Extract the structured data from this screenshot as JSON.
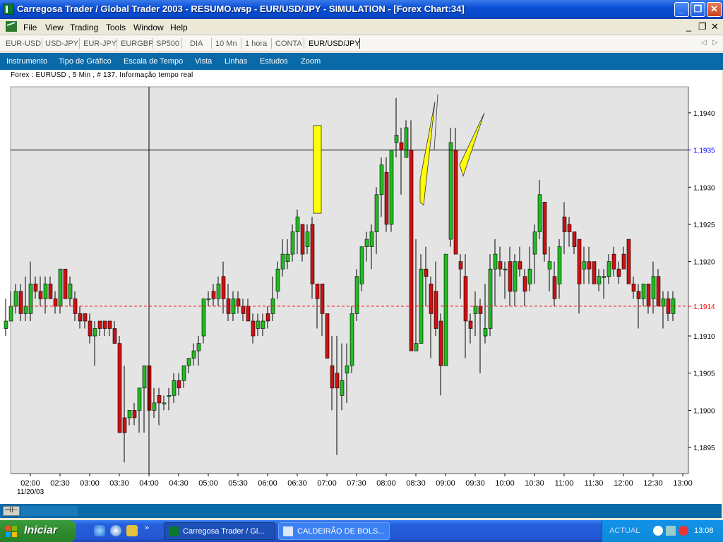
{
  "window": {
    "title": "Carregosa Trader / Global Trader 2003 - RESUMO.wsp - EUR/USD/JPY - SIMULATION - [Forex Chart:34]"
  },
  "title_buttons": {
    "minimize": "_",
    "maximize": "❐",
    "close": "✕"
  },
  "menu": {
    "items": [
      "File",
      "View",
      "Trading",
      "Tools",
      "Window",
      "Help"
    ],
    "mdi_min": "_",
    "mdi_restore": "❐",
    "mdi_close": "✕"
  },
  "symbols": {
    "items": [
      "EUR-USD",
      "USD-JPY",
      "EUR-JPY",
      "EURGBP",
      "SP500",
      "DIA",
      "10 Mn",
      "1 hora",
      "CONTA",
      "EUR/USD/JPY"
    ],
    "active_index": 9,
    "prev": "◁",
    "next": "▷"
  },
  "toolbar": {
    "items": [
      "Instrumento",
      "Tipo de Gráfico",
      "Escala de Tempo",
      "Vista",
      "Linhas",
      "Estudos",
      "Zoom"
    ]
  },
  "chart_info": "Forex : EURUSD , 5 Min , # 137, Informação tempo real",
  "chart_data": {
    "type": "candlestick",
    "date_label": "11/20/03",
    "x_ticks": [
      "02:00",
      "02:30",
      "03:00",
      "03:30",
      "04:00",
      "04:30",
      "05:00",
      "05:30",
      "06:00",
      "06:30",
      "07:00",
      "07:30",
      "08:00",
      "08:30",
      "09:00",
      "09:30",
      "10:00",
      "10:30",
      "11:00",
      "11:30",
      "12:00",
      "12:30",
      "13:00"
    ],
    "y_ticks": [
      "1,1895",
      "1,1900",
      "1,1905",
      "1,1910",
      "1,1920",
      "1,1925",
      "1,1930",
      "1,1940"
    ],
    "ylim": [
      1.18915,
      1.19435
    ],
    "crosshair": {
      "price": "1,1935",
      "time": "04:00",
      "price_color": "#0000ff"
    },
    "last_price": {
      "label": "1,1914",
      "color": "#ff0000",
      "line": "dashed"
    },
    "colors": {
      "up": "#22bb22",
      "down": "#cc1111",
      "background": "#e4e4e4",
      "annotation": "#ffff00"
    },
    "candles": [
      {
        "t": "01:35",
        "o": 1.1911,
        "h": 1.1915,
        "l": 1.191,
        "c": 1.1912
      },
      {
        "t": "01:40",
        "o": 1.1912,
        "h": 1.1916,
        "l": 1.1912,
        "c": 1.1914
      },
      {
        "t": "01:45",
        "o": 1.1914,
        "h": 1.1917,
        "l": 1.1913,
        "c": 1.1916
      },
      {
        "t": "01:50",
        "o": 1.1916,
        "h": 1.1917,
        "l": 1.1912,
        "c": 1.1913
      },
      {
        "t": "01:55",
        "o": 1.1913,
        "h": 1.1918,
        "l": 1.1912,
        "c": 1.1914
      },
      {
        "t": "02:00",
        "o": 1.1913,
        "h": 1.192,
        "l": 1.1912,
        "c": 1.1917
      },
      {
        "t": "02:05",
        "o": 1.1917,
        "h": 1.1918,
        "l": 1.1915,
        "c": 1.1916
      },
      {
        "t": "02:10",
        "o": 1.1916,
        "h": 1.1918,
        "l": 1.1914,
        "c": 1.1915
      },
      {
        "t": "02:15",
        "o": 1.1915,
        "h": 1.1918,
        "l": 1.1913,
        "c": 1.1917
      },
      {
        "t": "02:20",
        "o": 1.1917,
        "h": 1.1918,
        "l": 1.1915,
        "c": 1.1915
      },
      {
        "t": "02:25",
        "o": 1.1915,
        "h": 1.1916,
        "l": 1.1913,
        "c": 1.1914
      },
      {
        "t": "02:30",
        "o": 1.1914,
        "h": 1.1919,
        "l": 1.1913,
        "c": 1.1919
      },
      {
        "t": "02:35",
        "o": 1.1919,
        "h": 1.1919,
        "l": 1.1915,
        "c": 1.1915
      },
      {
        "t": "02:40",
        "o": 1.1915,
        "h": 1.1918,
        "l": 1.1914,
        "c": 1.1917
      },
      {
        "t": "02:45",
        "o": 1.1915,
        "h": 1.1916,
        "l": 1.1912,
        "c": 1.1913
      },
      {
        "t": "02:50",
        "o": 1.1913,
        "h": 1.1914,
        "l": 1.1911,
        "c": 1.1912
      },
      {
        "t": "02:55",
        "o": 1.1913,
        "h": 1.1913,
        "l": 1.1911,
        "c": 1.1912
      },
      {
        "t": "03:00",
        "o": 1.1912,
        "h": 1.1913,
        "l": 1.1909,
        "c": 1.191
      },
      {
        "t": "03:05",
        "o": 1.191,
        "h": 1.1912,
        "l": 1.1906,
        "c": 1.1911
      },
      {
        "t": "03:10",
        "o": 1.1912,
        "h": 1.1912,
        "l": 1.191,
        "c": 1.1911
      },
      {
        "t": "03:15",
        "o": 1.1912,
        "h": 1.1912,
        "l": 1.191,
        "c": 1.1911
      },
      {
        "t": "03:20",
        "o": 1.1912,
        "h": 1.1912,
        "l": 1.191,
        "c": 1.1911
      },
      {
        "t": "03:25",
        "o": 1.1911,
        "h": 1.1912,
        "l": 1.1909,
        "c": 1.1909
      },
      {
        "t": "03:30",
        "o": 1.1909,
        "h": 1.191,
        "l": 1.1899,
        "c": 1.1897
      },
      {
        "t": "03:35",
        "o": 1.1899,
        "h": 1.1906,
        "l": 1.1893,
        "c": 1.1897
      },
      {
        "t": "03:40",
        "o": 1.1899,
        "h": 1.19,
        "l": 1.1898,
        "c": 1.19
      },
      {
        "t": "03:45",
        "o": 1.19,
        "h": 1.1901,
        "l": 1.1898,
        "c": 1.1899
      },
      {
        "t": "03:50",
        "o": 1.19,
        "h": 1.1903,
        "l": 1.1897,
        "c": 1.1903
      },
      {
        "t": "03:55",
        "o": 1.1903,
        "h": 1.1906,
        "l": 1.1897,
        "c": 1.1906
      },
      {
        "t": "04:00",
        "o": 1.1906,
        "h": 1.1906,
        "l": 1.19,
        "c": 1.19
      },
      {
        "t": "04:05",
        "o": 1.19,
        "h": 1.1903,
        "l": 1.1899,
        "c": 1.1901
      },
      {
        "t": "04:10",
        "o": 1.1902,
        "h": 1.1903,
        "l": 1.1898,
        "c": 1.1901
      },
      {
        "t": "04:15",
        "o": 1.1901,
        "h": 1.1902,
        "l": 1.19,
        "c": 1.1901
      },
      {
        "t": "04:20",
        "o": 1.1902,
        "h": 1.1903,
        "l": 1.19,
        "c": 1.1902
      },
      {
        "t": "04:25",
        "o": 1.1902,
        "h": 1.1905,
        "l": 1.1901,
        "c": 1.1904
      },
      {
        "t": "04:30",
        "o": 1.1904,
        "h": 1.1905,
        "l": 1.1902,
        "c": 1.1903
      },
      {
        "t": "04:35",
        "o": 1.1904,
        "h": 1.1906,
        "l": 1.1903,
        "c": 1.1906
      },
      {
        "t": "04:40",
        "o": 1.1906,
        "h": 1.1907,
        "l": 1.1905,
        "c": 1.1907
      },
      {
        "t": "04:45",
        "o": 1.1907,
        "h": 1.1909,
        "l": 1.1906,
        "c": 1.1908
      },
      {
        "t": "04:50",
        "o": 1.1908,
        "h": 1.191,
        "l": 1.1906,
        "c": 1.1909
      },
      {
        "t": "04:55",
        "o": 1.191,
        "h": 1.1915,
        "l": 1.1909,
        "c": 1.1915
      },
      {
        "t": "05:00",
        "o": 1.1915,
        "h": 1.1916,
        "l": 1.1914,
        "c": 1.1915
      },
      {
        "t": "05:05",
        "o": 1.1916,
        "h": 1.1917,
        "l": 1.1914,
        "c": 1.1915
      },
      {
        "t": "05:10",
        "o": 1.1915,
        "h": 1.1918,
        "l": 1.1914,
        "c": 1.1917
      },
      {
        "t": "05:15",
        "o": 1.1918,
        "h": 1.192,
        "l": 1.1913,
        "c": 1.1915
      },
      {
        "t": "05:20",
        "o": 1.1915,
        "h": 1.1917,
        "l": 1.1912,
        "c": 1.1913
      },
      {
        "t": "05:25",
        "o": 1.1913,
        "h": 1.1916,
        "l": 1.1912,
        "c": 1.1915
      },
      {
        "t": "05:30",
        "o": 1.1915,
        "h": 1.1916,
        "l": 1.1913,
        "c": 1.1914
      },
      {
        "t": "05:35",
        "o": 1.1914,
        "h": 1.1915,
        "l": 1.1912,
        "c": 1.1913
      },
      {
        "t": "05:40",
        "o": 1.1914,
        "h": 1.1915,
        "l": 1.1912,
        "c": 1.1912
      },
      {
        "t": "05:45",
        "o": 1.1912,
        "h": 1.1913,
        "l": 1.1909,
        "c": 1.191
      },
      {
        "t": "05:50",
        "o": 1.1911,
        "h": 1.1913,
        "l": 1.191,
        "c": 1.1912
      },
      {
        "t": "05:55",
        "o": 1.1911,
        "h": 1.1913,
        "l": 1.191,
        "c": 1.1912
      },
      {
        "t": "06:00",
        "o": 1.1913,
        "h": 1.1914,
        "l": 1.1911,
        "c": 1.1912
      },
      {
        "t": "06:05",
        "o": 1.1913,
        "h": 1.1918,
        "l": 1.1912,
        "c": 1.1915
      },
      {
        "t": "06:10",
        "o": 1.1916,
        "h": 1.192,
        "l": 1.1915,
        "c": 1.1919
      },
      {
        "t": "06:15",
        "o": 1.1919,
        "h": 1.1923,
        "l": 1.1918,
        "c": 1.1921
      },
      {
        "t": "06:20",
        "o": 1.192,
        "h": 1.1923,
        "l": 1.1919,
        "c": 1.1921
      },
      {
        "t": "06:25",
        "o": 1.1921,
        "h": 1.1925,
        "l": 1.192,
        "c": 1.1924
      },
      {
        "t": "06:30",
        "o": 1.1924,
        "h": 1.1927,
        "l": 1.1921,
        "c": 1.1926
      },
      {
        "t": "06:35",
        "o": 1.1925,
        "h": 1.1925,
        "l": 1.192,
        "c": 1.1921
      },
      {
        "t": "06:40",
        "o": 1.1922,
        "h": 1.1925,
        "l": 1.1921,
        "c": 1.1924
      },
      {
        "t": "06:45",
        "o": 1.1925,
        "h": 1.1926,
        "l": 1.1915,
        "c": 1.1917
      },
      {
        "t": "06:50",
        "o": 1.1917,
        "h": 1.1917,
        "l": 1.1911,
        "c": 1.1915
      },
      {
        "t": "06:55",
        "o": 1.1917,
        "h": 1.1917,
        "l": 1.191,
        "c": 1.1913
      },
      {
        "t": "07:00",
        "o": 1.1913,
        "h": 1.1913,
        "l": 1.1907,
        "c": 1.1907
      },
      {
        "t": "07:05",
        "o": 1.1906,
        "h": 1.191,
        "l": 1.19,
        "c": 1.1903
      },
      {
        "t": "07:10",
        "o": 1.1905,
        "h": 1.191,
        "l": 1.1894,
        "c": 1.1903
      },
      {
        "t": "07:15",
        "o": 1.1902,
        "h": 1.1909,
        "l": 1.19,
        "c": 1.1904
      },
      {
        "t": "07:20",
        "o": 1.1905,
        "h": 1.1909,
        "l": 1.1901,
        "c": 1.1906
      },
      {
        "t": "07:25",
        "o": 1.1906,
        "h": 1.1914,
        "l": 1.1905,
        "c": 1.1913
      },
      {
        "t": "07:30",
        "o": 1.1913,
        "h": 1.1919,
        "l": 1.1912,
        "c": 1.1918
      },
      {
        "t": "07:35",
        "o": 1.1917,
        "h": 1.1922,
        "l": 1.1916,
        "c": 1.1922
      },
      {
        "t": "07:40",
        "o": 1.1922,
        "h": 1.1924,
        "l": 1.192,
        "c": 1.1923
      },
      {
        "t": "07:45",
        "o": 1.1922,
        "h": 1.1925,
        "l": 1.1919,
        "c": 1.1924
      },
      {
        "t": "07:50",
        "o": 1.1924,
        "h": 1.193,
        "l": 1.1921,
        "c": 1.1929
      },
      {
        "t": "07:55",
        "o": 1.1929,
        "h": 1.1934,
        "l": 1.1926,
        "c": 1.1933
      },
      {
        "t": "08:00",
        "o": 1.1932,
        "h": 1.1934,
        "l": 1.1924,
        "c": 1.1925
      },
      {
        "t": "08:05",
        "o": 1.1925,
        "h": 1.1935,
        "l": 1.1924,
        "c": 1.1935
      },
      {
        "t": "08:10",
        "o": 1.1936,
        "h": 1.1942,
        "l": 1.1934,
        "c": 1.1937
      },
      {
        "t": "08:15",
        "o": 1.1936,
        "h": 1.1938,
        "l": 1.1929,
        "c": 1.1935
      },
      {
        "t": "08:20",
        "o": 1.1934,
        "h": 1.1939,
        "l": 1.1934,
        "c": 1.1938
      },
      {
        "t": "08:25",
        "o": 1.1935,
        "h": 1.1939,
        "l": 1.1908,
        "c": 1.1908
      },
      {
        "t": "08:30",
        "o": 1.1908,
        "h": 1.1923,
        "l": 1.1908,
        "c": 1.1909
      },
      {
        "t": "08:35",
        "o": 1.1909,
        "h": 1.1921,
        "l": 1.1909,
        "c": 1.1919
      },
      {
        "t": "08:40",
        "o": 1.1919,
        "h": 1.1922,
        "l": 1.1914,
        "c": 1.1918
      },
      {
        "t": "08:45",
        "o": 1.1917,
        "h": 1.1918,
        "l": 1.1907,
        "c": 1.1913
      },
      {
        "t": "08:50",
        "o": 1.1916,
        "h": 1.192,
        "l": 1.191,
        "c": 1.1911
      },
      {
        "t": "08:55",
        "o": 1.1912,
        "h": 1.1913,
        "l": 1.1902,
        "c": 1.1906
      },
      {
        "t": "09:00",
        "o": 1.1906,
        "h": 1.1921,
        "l": 1.1906,
        "c": 1.1921
      },
      {
        "t": "09:05",
        "o": 1.1923,
        "h": 1.1938,
        "l": 1.1922,
        "c": 1.1936
      },
      {
        "t": "09:10",
        "o": 1.1935,
        "h": 1.1938,
        "l": 1.1921,
        "c": 1.1921
      },
      {
        "t": "09:15",
        "o": 1.192,
        "h": 1.1921,
        "l": 1.1915,
        "c": 1.1919
      },
      {
        "t": "09:20",
        "o": 1.1918,
        "h": 1.1921,
        "l": 1.1907,
        "c": 1.1912
      },
      {
        "t": "09:25",
        "o": 1.1912,
        "h": 1.1913,
        "l": 1.1909,
        "c": 1.1911
      },
      {
        "t": "09:30",
        "o": 1.1913,
        "h": 1.1916,
        "l": 1.191,
        "c": 1.1914
      },
      {
        "t": "09:35",
        "o": 1.1914,
        "h": 1.1915,
        "l": 1.1905,
        "c": 1.1913
      },
      {
        "t": "09:40",
        "o": 1.191,
        "h": 1.1917,
        "l": 1.1909,
        "c": 1.1911
      },
      {
        "t": "09:45",
        "o": 1.1911,
        "h": 1.1921,
        "l": 1.191,
        "c": 1.1919
      },
      {
        "t": "09:50",
        "o": 1.1919,
        "h": 1.1923,
        "l": 1.1914,
        "c": 1.1921
      },
      {
        "t": "09:55",
        "o": 1.192,
        "h": 1.1922,
        "l": 1.1918,
        "c": 1.1919
      },
      {
        "t": "10:00",
        "o": 1.1919,
        "h": 1.192,
        "l": 1.1915,
        "c": 1.1919
      },
      {
        "t": "10:05",
        "o": 1.192,
        "h": 1.1922,
        "l": 1.1914,
        "c": 1.1916
      },
      {
        "t": "10:10",
        "o": 1.1916,
        "h": 1.1921,
        "l": 1.1914,
        "c": 1.192
      },
      {
        "t": "10:15",
        "o": 1.192,
        "h": 1.1922,
        "l": 1.1918,
        "c": 1.1919
      },
      {
        "t": "10:20",
        "o": 1.1918,
        "h": 1.1919,
        "l": 1.1914,
        "c": 1.1916
      },
      {
        "t": "10:25",
        "o": 1.1917,
        "h": 1.1922,
        "l": 1.1916,
        "c": 1.1919
      },
      {
        "t": "10:30",
        "o": 1.1921,
        "h": 1.1925,
        "l": 1.1917,
        "c": 1.1924
      },
      {
        "t": "10:35",
        "o": 1.1924,
        "h": 1.1931,
        "l": 1.1923,
        "c": 1.1929
      },
      {
        "t": "10:40",
        "o": 1.1928,
        "h": 1.1928,
        "l": 1.192,
        "c": 1.1921
      },
      {
        "t": "10:45",
        "o": 1.1919,
        "h": 1.1922,
        "l": 1.1916,
        "c": 1.192
      },
      {
        "t": "10:50",
        "o": 1.1918,
        "h": 1.192,
        "l": 1.1914,
        "c": 1.1915
      },
      {
        "t": "10:55",
        "o": 1.1917,
        "h": 1.1923,
        "l": 1.1915,
        "c": 1.1922
      },
      {
        "t": "11:00",
        "o": 1.1926,
        "h": 1.1928,
        "l": 1.1921,
        "c": 1.1924
      },
      {
        "t": "11:05",
        "o": 1.1925,
        "h": 1.1926,
        "l": 1.1922,
        "c": 1.1924
      },
      {
        "t": "11:10",
        "o": 1.1924,
        "h": 1.1924,
        "l": 1.1921,
        "c": 1.1922
      },
      {
        "t": "11:15",
        "o": 1.1923,
        "h": 1.1923,
        "l": 1.1913,
        "c": 1.1917
      },
      {
        "t": "11:20",
        "o": 1.1919,
        "h": 1.1922,
        "l": 1.1917,
        "c": 1.192
      },
      {
        "t": "11:25",
        "o": 1.192,
        "h": 1.1922,
        "l": 1.1917,
        "c": 1.1919
      },
      {
        "t": "11:30",
        "o": 1.192,
        "h": 1.192,
        "l": 1.1917,
        "c": 1.1917
      },
      {
        "t": "11:35",
        "o": 1.1917,
        "h": 1.1919,
        "l": 1.1916,
        "c": 1.1918
      },
      {
        "t": "11:40",
        "o": 1.1918,
        "h": 1.1919,
        "l": 1.1915,
        "c": 1.1918
      },
      {
        "t": "11:45",
        "o": 1.1918,
        "h": 1.1921,
        "l": 1.1917,
        "c": 1.192
      },
      {
        "t": "11:50",
        "o": 1.1921,
        "h": 1.1922,
        "l": 1.1918,
        "c": 1.1919
      },
      {
        "t": "11:55",
        "o": 1.1919,
        "h": 1.192,
        "l": 1.1917,
        "c": 1.1918
      },
      {
        "t": "12:00",
        "o": 1.1921,
        "h": 1.1922,
        "l": 1.1919,
        "c": 1.1919
      },
      {
        "t": "12:05",
        "o": 1.1923,
        "h": 1.1923,
        "l": 1.1917,
        "c": 1.1917
      },
      {
        "t": "12:10",
        "o": 1.1917,
        "h": 1.1918,
        "l": 1.1915,
        "c": 1.1916
      },
      {
        "t": "12:15",
        "o": 1.1916,
        "h": 1.1917,
        "l": 1.1911,
        "c": 1.1915
      },
      {
        "t": "12:20",
        "o": 1.1915,
        "h": 1.1917,
        "l": 1.1914,
        "c": 1.1917
      },
      {
        "t": "12:25",
        "o": 1.1917,
        "h": 1.1917,
        "l": 1.1913,
        "c": 1.1914
      },
      {
        "t": "12:30",
        "o": 1.1915,
        "h": 1.192,
        "l": 1.1913,
        "c": 1.1918
      },
      {
        "t": "12:35",
        "o": 1.1918,
        "h": 1.1919,
        "l": 1.1914,
        "c": 1.1914
      },
      {
        "t": "12:40",
        "o": 1.1914,
        "h": 1.1916,
        "l": 1.1911,
        "c": 1.1915
      },
      {
        "t": "12:45",
        "o": 1.1915,
        "h": 1.1916,
        "l": 1.1912,
        "c": 1.1913
      },
      {
        "t": "12:50",
        "o": 1.1913,
        "h": 1.1916,
        "l": 1.1912,
        "c": 1.1915
      }
    ]
  },
  "scrollbar": {
    "left_button": "⊣⊢"
  },
  "taskbar": {
    "start_label": "Iniciar",
    "quicklaunch_more": "»",
    "tasks": [
      "Carregosa Trader / Gl...",
      "CALDEIRÃO DE BOLS..."
    ],
    "tray_text": "ACTUAL",
    "clock": "13:08"
  }
}
